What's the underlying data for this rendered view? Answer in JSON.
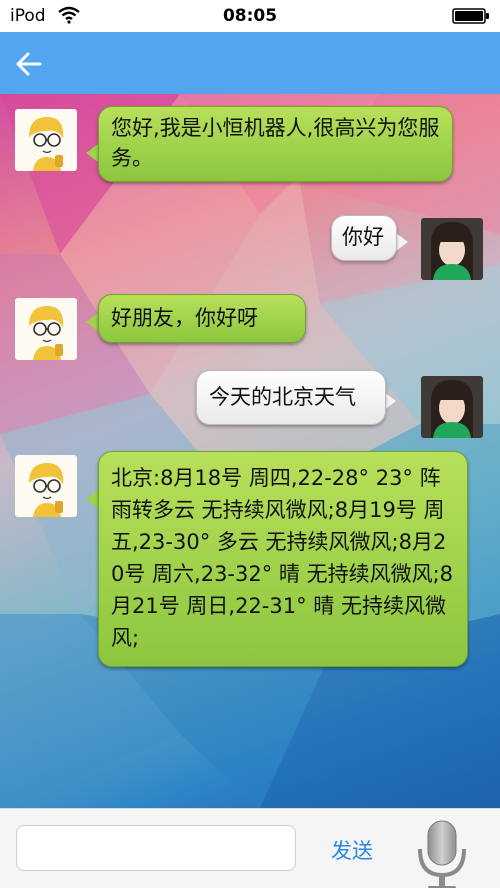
{
  "status_bar": {
    "carrier": "iPod",
    "time": "08:05",
    "icons": [
      "wifi-icon",
      "battery-icon"
    ]
  },
  "nav_bar": {
    "back_icon": "back-arrow-icon",
    "color": "#53a5f0"
  },
  "messages": [
    {
      "sender": "bot",
      "text": "您好,我是小恒机器人,很高兴为您服务。"
    },
    {
      "sender": "user",
      "text": "你好"
    },
    {
      "sender": "bot",
      "text": "好朋友，你好呀"
    },
    {
      "sender": "user",
      "text": "今天的北京天气"
    },
    {
      "sender": "bot",
      "text": "北京:8月18号 周四,22-28° 23° 阵雨转多云 无持续风微风;8月19号 周五,23-30° 多云 无持续风微风;8月20号 周六,23-32° 晴 无持续风微风;8月21号 周日,22-31° 晴 无持续风微风;"
    }
  ],
  "input_bar": {
    "input_value": "",
    "input_placeholder": "",
    "send_label": "发送",
    "mic_icon": "microphone-icon",
    "send_color": "#2b86e6"
  },
  "colors": {
    "bot_bubble": "#9fd34a",
    "user_bubble": "#f4f4f4"
  }
}
